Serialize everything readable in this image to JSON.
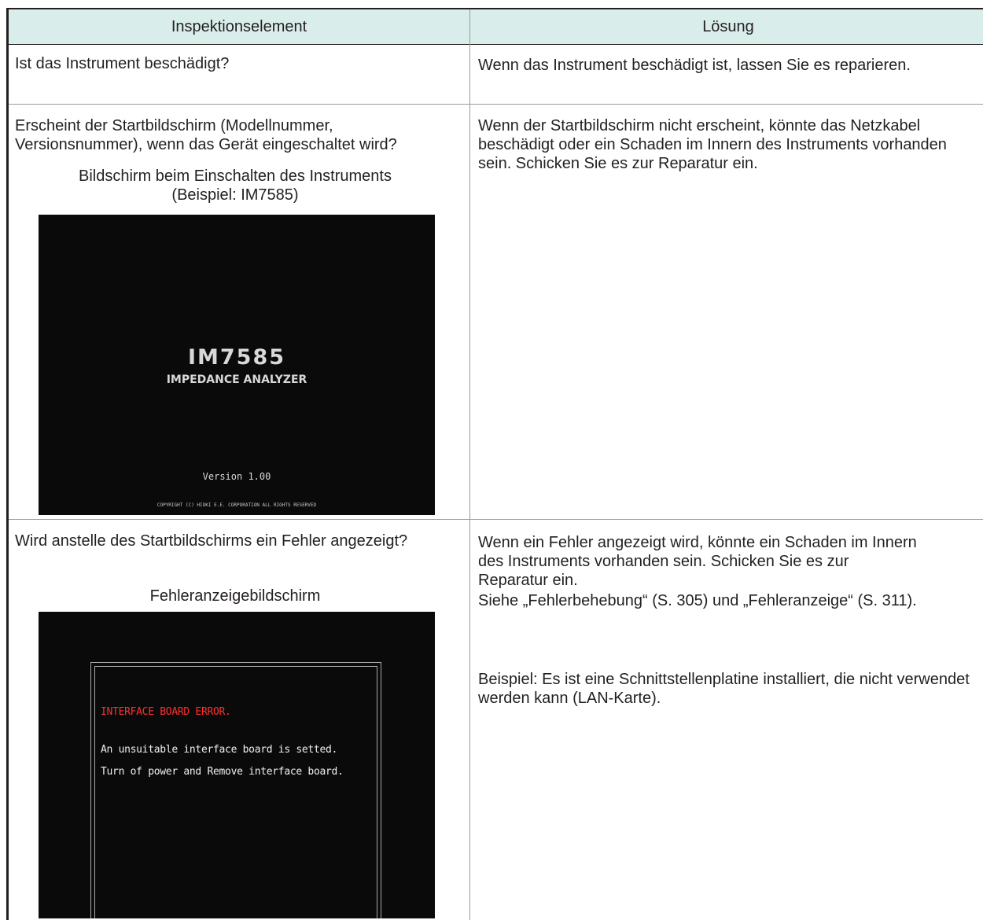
{
  "header": {
    "col_item": "Inspektionselement",
    "col_solution": "Lösung"
  },
  "rows": [
    {
      "item": "Ist das Instrument beschädigt?",
      "solution": "Wenn das Instrument beschädigt ist, lassen Sie es reparieren."
    },
    {
      "item": "Erscheint der Startbildschirm (Modellnummer, Versionsnummer), wenn das Gerät eingeschaltet wird?",
      "caption": "Bildschirm beim Einschalten des Instruments (Beispiel: IM7585)",
      "screen": {
        "model": "IM7585",
        "name": "IMPEDANCE ANALYZER",
        "version": "Version 1.00",
        "copyright": "COPYRIGHT (C) HIOKI E.E. CORPORATION ALL RIGHTS RESERVED"
      },
      "solution": "Wenn der Startbildschirm nicht erscheint, könnte das Netzkabel beschädigt oder ein Schaden im Innern des Instruments vorhanden sein. Schicken Sie es zur Reparatur ein."
    },
    {
      "item": "Wird anstelle des Startbildschirms ein Fehler angezeigt?",
      "caption": "Fehleranzeigebildschirm",
      "screen": {
        "error_title": "INTERFACE BOARD ERROR.",
        "line1": "An unsuitable interface board is setted.",
        "line2": "Turn of power and Remove interface board."
      },
      "solution": "Wenn ein Fehler angezeigt wird, könnte ein Schaden im Innern des Instruments vorhanden sein. Schicken Sie es zur Reparatur ein.",
      "reference": "Siehe „Fehlerbehebung“ (S. 305) und „Fehleranzeige“ (S. 311).",
      "example": "Beispiel: Es ist eine Schnittstellenplatine installiert, die nicht verwendet werden kann (LAN-Karte)."
    }
  ]
}
